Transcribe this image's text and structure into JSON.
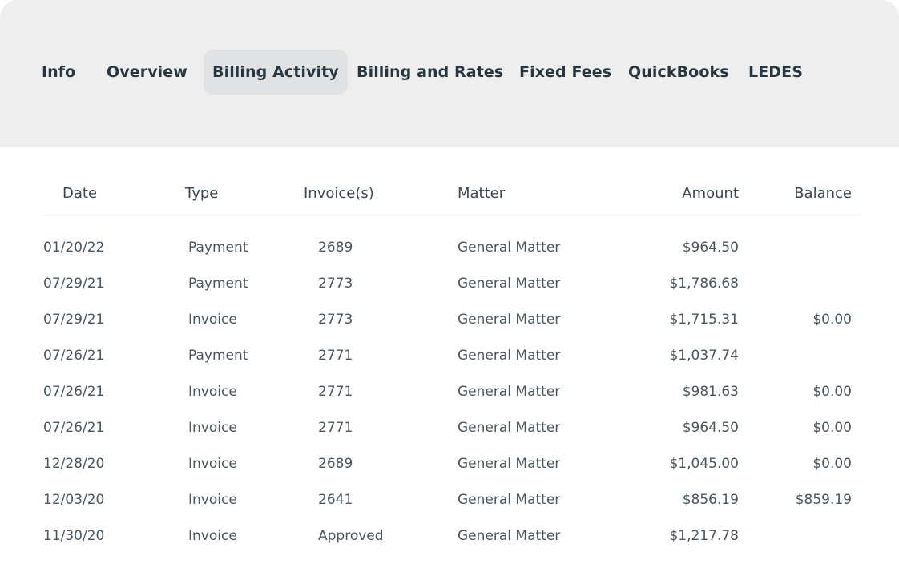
{
  "tabs": [
    {
      "label": "Info",
      "active": false
    },
    {
      "label": "Overview",
      "active": false
    },
    {
      "label": "Billing Activity",
      "active": true
    },
    {
      "label": "Billing and Rates",
      "active": false
    },
    {
      "label": "Fixed Fees",
      "active": false
    },
    {
      "label": "QuickBooks",
      "active": false
    },
    {
      "label": "LEDES",
      "active": false
    }
  ],
  "table": {
    "headers": {
      "date": "Date",
      "type": "Type",
      "invoices": "Invoice(s)",
      "matter": "Matter",
      "amount": "Amount",
      "balance": "Balance"
    },
    "rows": [
      {
        "date": "01/20/22",
        "type": "Payment",
        "invoices": "2689",
        "matter": "General Matter",
        "amount": "$964.50",
        "balance": ""
      },
      {
        "date": "07/29/21",
        "type": "Payment",
        "invoices": "2773",
        "matter": "General Matter",
        "amount": "$1,786.68",
        "balance": ""
      },
      {
        "date": "07/29/21",
        "type": "Invoice",
        "invoices": "2773",
        "matter": "General Matter",
        "amount": "$1,715.31",
        "balance": "$0.00"
      },
      {
        "date": "07/26/21",
        "type": "Payment",
        "invoices": "2771",
        "matter": "General Matter",
        "amount": "$1,037.74",
        "balance": ""
      },
      {
        "date": "07/26/21",
        "type": "Invoice",
        "invoices": "2771",
        "matter": "General Matter",
        "amount": "$981.63",
        "balance": "$0.00"
      },
      {
        "date": "07/26/21",
        "type": "Invoice",
        "invoices": "2771",
        "matter": "General Matter",
        "amount": "$964.50",
        "balance": "$0.00"
      },
      {
        "date": "12/28/20",
        "type": "Invoice",
        "invoices": "2689",
        "matter": "General Matter",
        "amount": "$1,045.00",
        "balance": "$0.00"
      },
      {
        "date": "12/03/20",
        "type": "Invoice",
        "invoices": "2641",
        "matter": "General Matter",
        "amount": "$856.19",
        "balance": "$859.19"
      },
      {
        "date": "11/30/20",
        "type": "Invoice",
        "invoices": "Approved",
        "matter": "General Matter",
        "amount": "$1,217.78",
        "balance": ""
      }
    ]
  }
}
